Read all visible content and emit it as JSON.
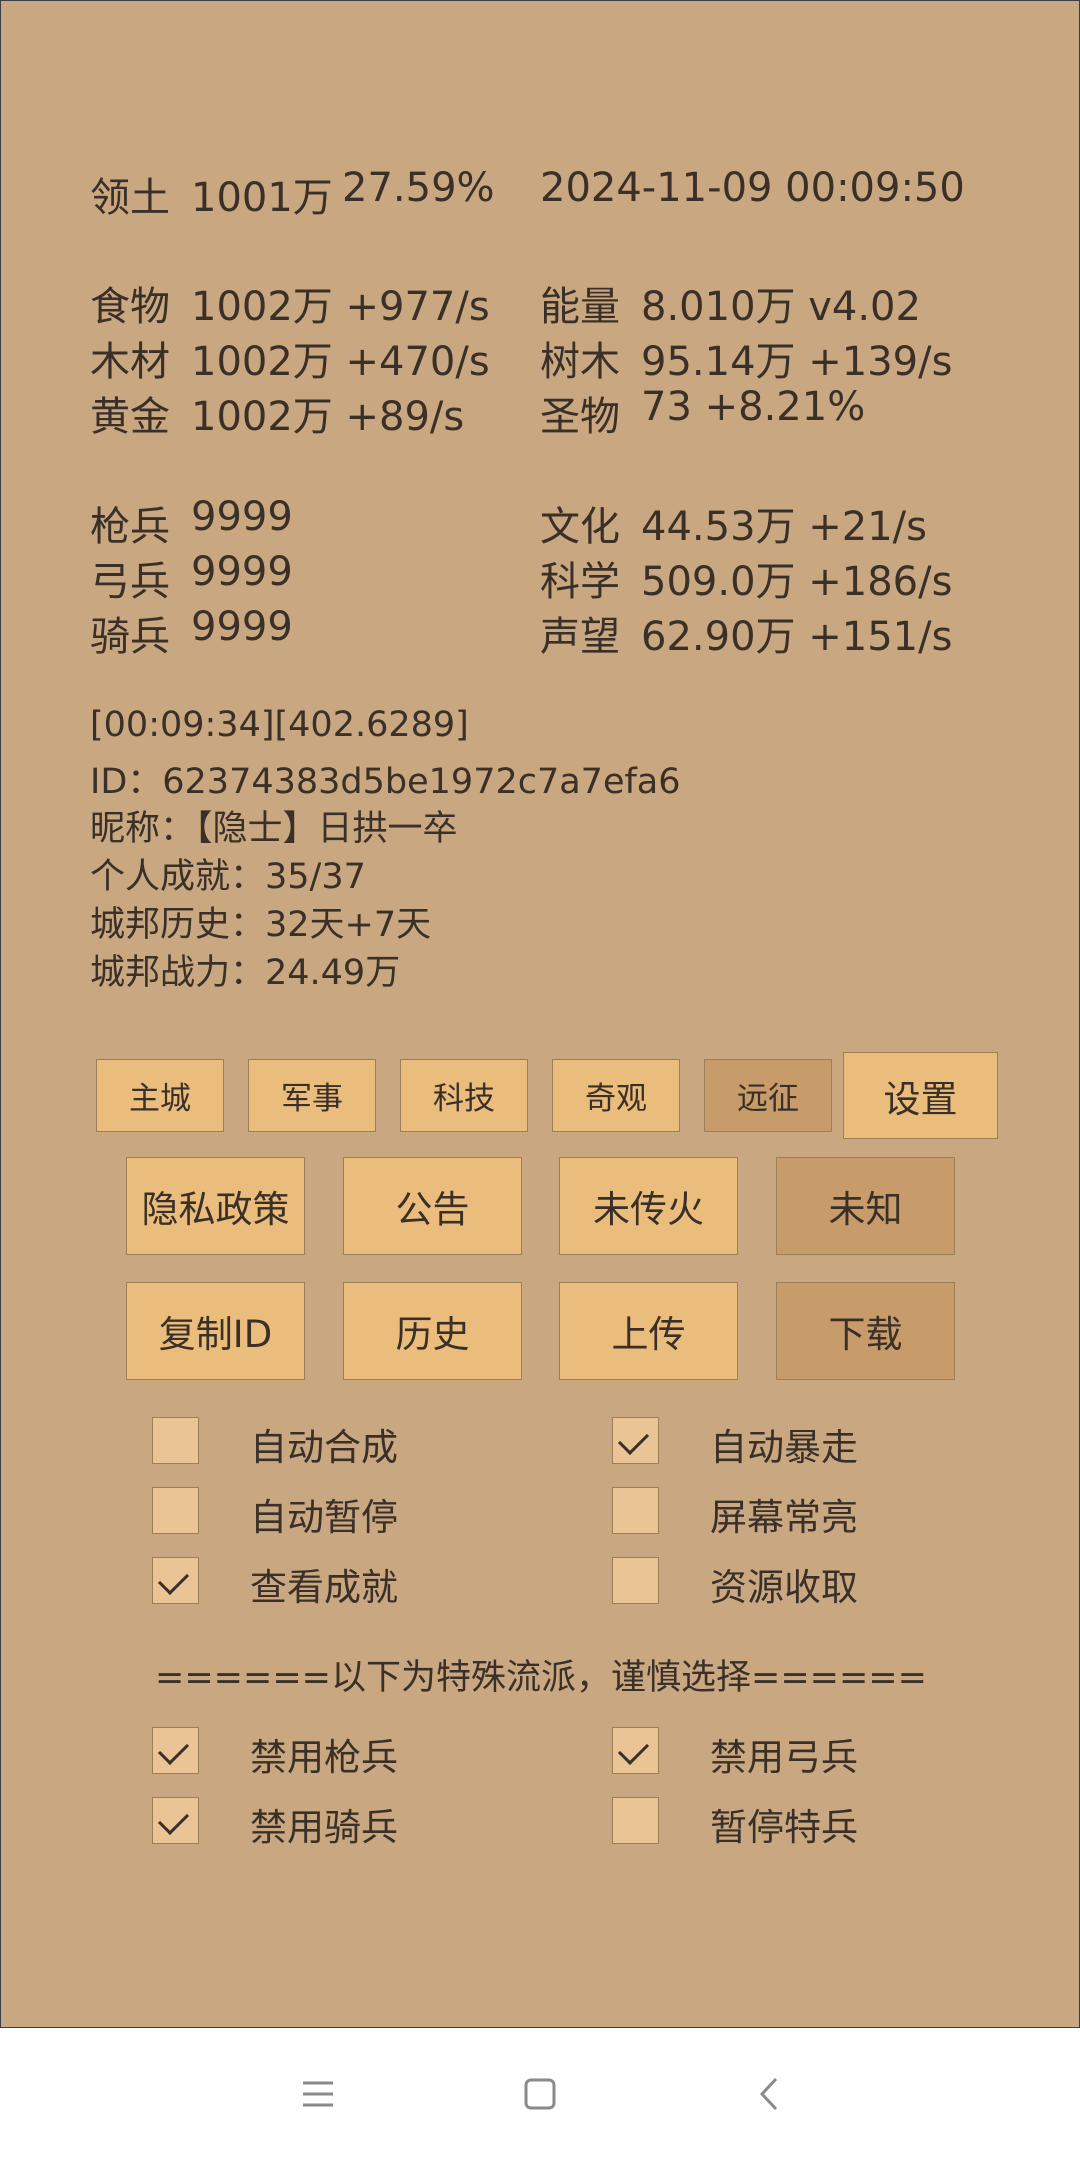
{
  "header": {
    "territory_label": "领土",
    "territory_value": "1001万",
    "territory_percent": "27.59%",
    "datetime": "2024-11-09 00:09:50"
  },
  "resources": [
    {
      "label": "食物",
      "value": "1002万 +977/s"
    },
    {
      "label": "木材",
      "value": "1002万 +470/s"
    },
    {
      "label": "黄金",
      "value": "1002万 +89/s"
    }
  ],
  "resources_right": [
    {
      "label": "能量",
      "value": "8.010万  v4.02"
    },
    {
      "label": "树木",
      "value": "95.14万 +139/s"
    },
    {
      "label": "圣物",
      "value": "73 +8.21%"
    }
  ],
  "troops": [
    {
      "label": "枪兵",
      "value": "9999"
    },
    {
      "label": "弓兵",
      "value": "9999"
    },
    {
      "label": "骑兵",
      "value": "9999"
    }
  ],
  "culture": [
    {
      "label": "文化",
      "value": "44.53万 +21/s"
    },
    {
      "label": "科学",
      "value": "509.0万 +186/s"
    },
    {
      "label": "声望",
      "value": "62.90万 +151/s"
    }
  ],
  "info": {
    "timer": "[00:09:34][402.6289]",
    "id_line": "ID：62374383d5be1972c7a7efa6",
    "nickname_line": "昵称：【隐士】日拱一卒",
    "achievements_line": "个人成就：35/37",
    "history_line": "城邦历史：32天+7天",
    "power_line": "城邦战力：24.49万"
  },
  "tabs": [
    "主城",
    "军事",
    "科技",
    "奇观",
    "远征"
  ],
  "settings_label": "设置",
  "row1_buttons": [
    "隐私政策",
    "公告",
    "未传火",
    "未知"
  ],
  "row2_buttons": [
    "复制ID",
    "历史",
    "上传",
    "下载"
  ],
  "options": [
    {
      "label": "自动合成",
      "checked": false
    },
    {
      "label": "自动暴走",
      "checked": true
    },
    {
      "label": "自动暂停",
      "checked": false
    },
    {
      "label": "屏幕常亮",
      "checked": false
    },
    {
      "label": "查看成就",
      "checked": true
    },
    {
      "label": "资源收取",
      "checked": false
    }
  ],
  "special_divider": "======以下为特殊流派，谨慎选择======",
  "special_options": [
    {
      "label": "禁用枪兵",
      "checked": true
    },
    {
      "label": "禁用弓兵",
      "checked": true
    },
    {
      "label": "禁用骑兵",
      "checked": true
    },
    {
      "label": "暂停特兵",
      "checked": false
    }
  ],
  "navbar": {
    "icons": [
      "menu-icon",
      "home-icon",
      "back-icon"
    ]
  }
}
